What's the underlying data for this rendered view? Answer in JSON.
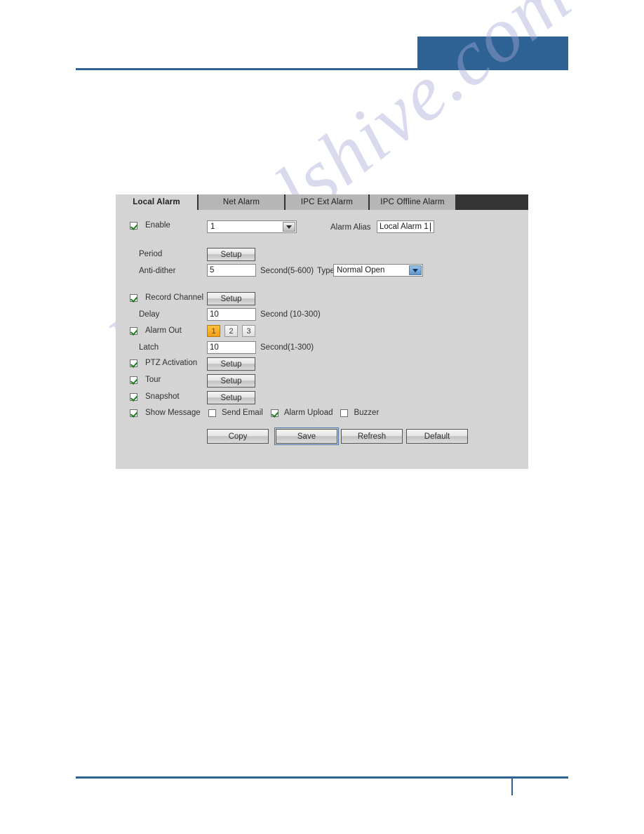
{
  "page": {
    "watermark": "manualshive.com",
    "accent_color": "#2e6194"
  },
  "panel": {
    "tabs": [
      {
        "label": "Local Alarm",
        "active": true
      },
      {
        "label": "Net Alarm",
        "active": false
      },
      {
        "label": "IPC Ext Alarm",
        "active": false
      },
      {
        "label": "IPC Offline Alarm",
        "active": false
      }
    ],
    "enable": {
      "label": "Enable",
      "checked": true,
      "channel_value": "1",
      "alias_label": "Alarm Alias",
      "alias_value": "Local Alarm 1"
    },
    "period": {
      "label": "Period",
      "setup_label": "Setup"
    },
    "anti_dither": {
      "label": "Anti-dither",
      "value": "5",
      "unit": "Second(5-600)",
      "type_label": "Type",
      "type_value": "Normal Open"
    },
    "record_channel": {
      "label": "Record Channel",
      "checked": true,
      "setup_label": "Setup"
    },
    "delay": {
      "label": "Delay",
      "value": "10",
      "unit": "Second (10-300)"
    },
    "alarm_out": {
      "label": "Alarm Out",
      "checked": true,
      "buttons": [
        "1",
        "2",
        "3"
      ],
      "selected": "1"
    },
    "latch": {
      "label": "Latch",
      "value": "10",
      "unit": "Second(1-300)"
    },
    "ptz_activation": {
      "label": "PTZ Activation",
      "checked": true,
      "setup_label": "Setup"
    },
    "tour": {
      "label": "Tour",
      "checked": true,
      "setup_label": "Setup"
    },
    "snapshot": {
      "label": "Snapshot",
      "checked": true,
      "setup_label": "Setup"
    },
    "show_message": {
      "label": "Show Message",
      "checked": true
    },
    "send_email": {
      "label": "Send Email",
      "checked": false
    },
    "alarm_upload": {
      "label": "Alarm Upload",
      "checked": true
    },
    "buzzer": {
      "label": "Buzzer",
      "checked": false
    },
    "actions": {
      "copy": "Copy",
      "save": "Save",
      "refresh": "Refresh",
      "default": "Default"
    }
  }
}
